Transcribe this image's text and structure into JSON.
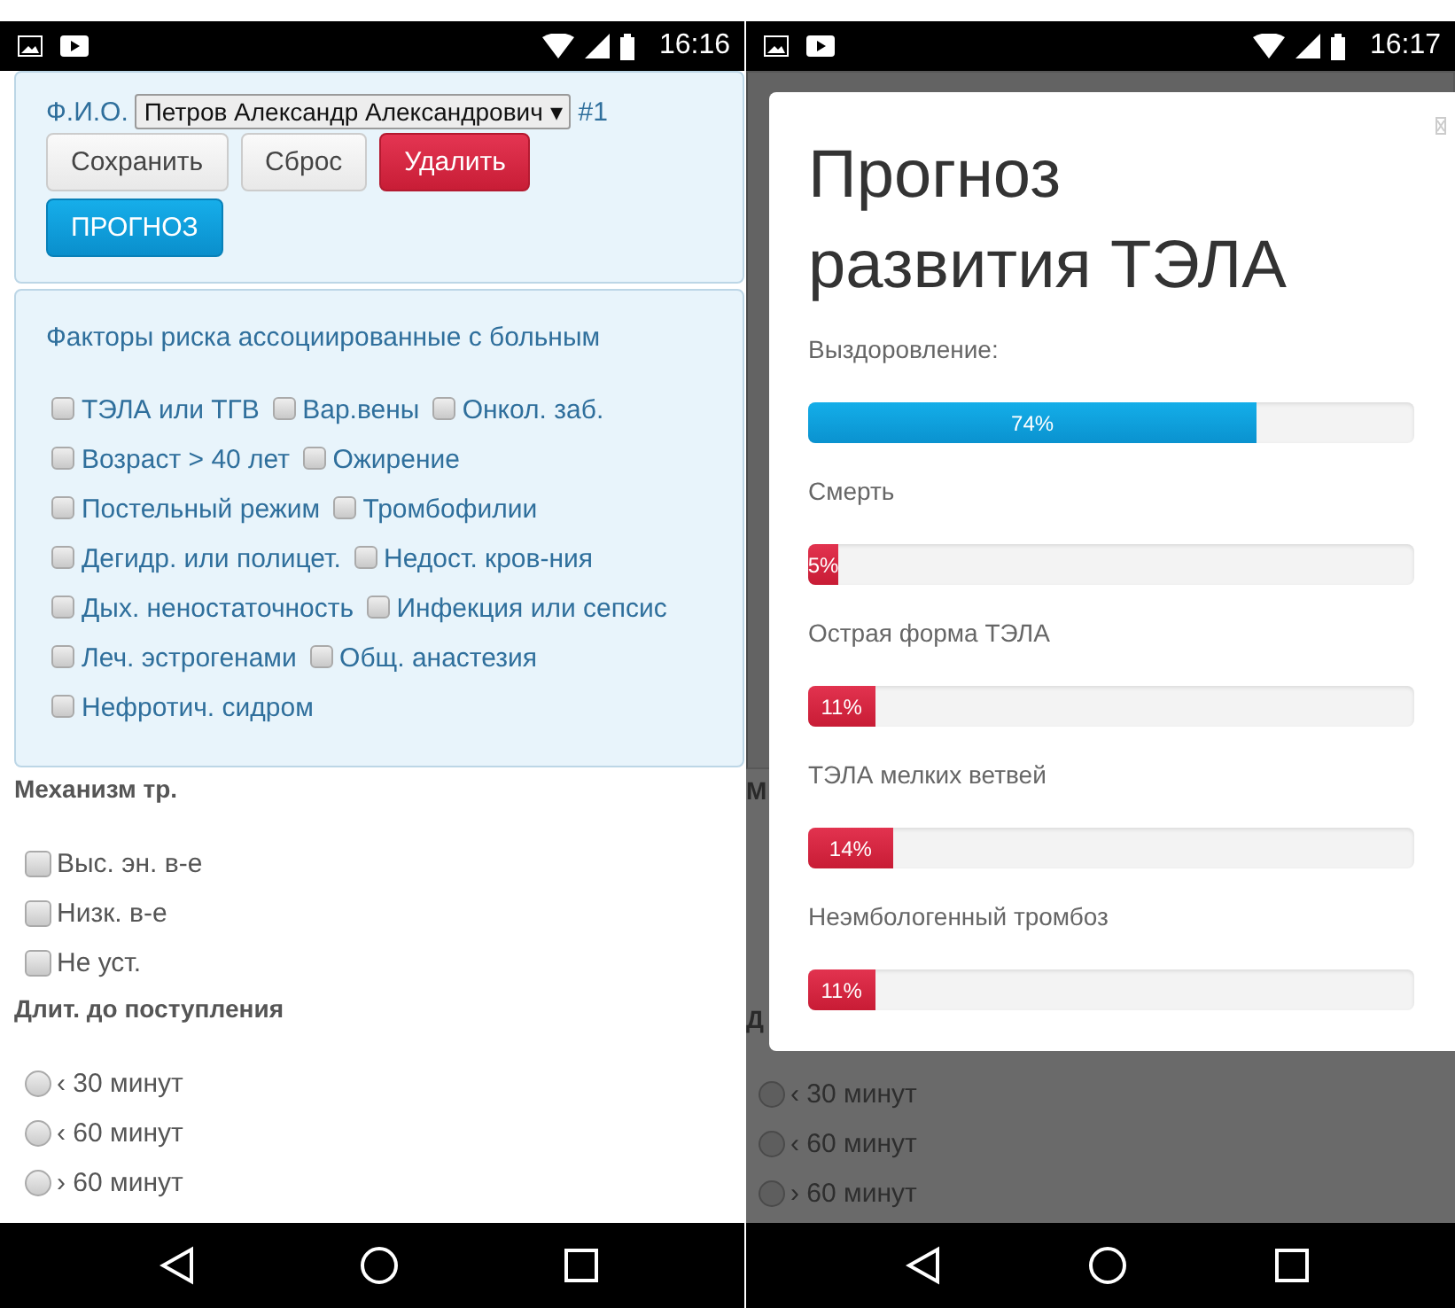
{
  "left_screen": {
    "status_time": "16:16",
    "patient_panel": {
      "label": "Ф.И.О.",
      "select_value": "Петров Александр Александрович ▾",
      "record": "#1",
      "buttons": [
        {
          "label": "Сохранить",
          "kind": "default"
        },
        {
          "label": "Сброс",
          "kind": "default"
        },
        {
          "label": "Удалить",
          "kind": "danger"
        },
        {
          "label": "ПРОГНОЗ",
          "kind": "primary"
        }
      ]
    },
    "risk_panel": {
      "title": "Факторы риска ассоциированные с больным",
      "factors": [
        {
          "label": "ТЭЛА или ТГВ",
          "checked": false
        },
        {
          "label": "Вар.вены",
          "checked": false
        },
        {
          "label": "Онкол. заб.",
          "checked": false
        },
        {
          "label": "Возраст > 40 лет",
          "checked": false
        },
        {
          "label": "Ожирение",
          "checked": false
        },
        {
          "label": "Постельный режим",
          "checked": false
        },
        {
          "label": "Тромбофилии",
          "checked": false
        },
        {
          "label": "Дегидр. или полицет.",
          "checked": false
        },
        {
          "label": "Недост. кров-ния",
          "checked": false
        },
        {
          "label": "Дых. неностаточность",
          "checked": false
        },
        {
          "label": "Инфекция или сепсис",
          "checked": false
        },
        {
          "label": "Леч. эстрогенами",
          "checked": false
        },
        {
          "label": "Общ. анастезия",
          "checked": false
        },
        {
          "label": "Нефротич. сидром",
          "checked": false
        }
      ]
    },
    "mechanism": {
      "heading": "Механизм тр.",
      "options": [
        {
          "label": "Выс. эн. в-е",
          "checked": false
        },
        {
          "label": "Низк. в-е",
          "checked": false
        },
        {
          "label": "Не уст.",
          "checked": false
        }
      ]
    },
    "duration": {
      "heading": "Длит. до поступления",
      "options": [
        {
          "label": "‹ 30 минут",
          "selected": false
        },
        {
          "label": "‹ 60 минут",
          "selected": false
        },
        {
          "label": "› 60 минут",
          "selected": false
        }
      ]
    }
  },
  "right_screen": {
    "status_time": "16:17",
    "background": {
      "heading_fragments": [
        "М",
        "Д"
      ],
      "options": [
        {
          "label": "‹ 30 минут",
          "selected": false
        },
        {
          "label": "‹ 60 минут",
          "selected": false
        },
        {
          "label": "› 60 минут",
          "selected": false
        }
      ]
    },
    "modal": {
      "title": "Прогноз развития ТЭЛА",
      "outcomes": [
        {
          "label": "Выздоровление:",
          "level": 0.74,
          "reading": "74%",
          "kind": "success"
        },
        {
          "label": "Смерть",
          "level": 0.05,
          "reading": "5%",
          "kind": "danger"
        },
        {
          "label": "Острая форма ТЭЛА",
          "level": 0.11,
          "reading": "11%",
          "kind": "danger"
        },
        {
          "label": "ТЭЛА мелких ветвей",
          "level": 0.14,
          "reading": "14%",
          "kind": "danger"
        },
        {
          "label": "Неэмбологенный тромбоз",
          "level": 0.11,
          "reading": "11%",
          "kind": "danger"
        }
      ]
    }
  }
}
